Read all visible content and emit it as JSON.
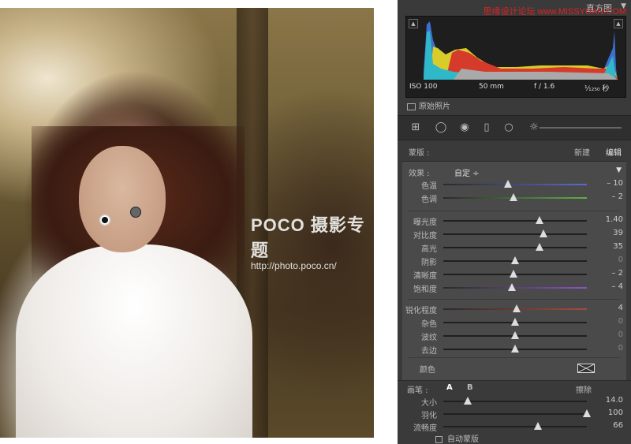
{
  "credit": "思缘设计论坛 www.MISSYUAN.COM",
  "watermark": {
    "title": "POCO 摄影专题",
    "url": "http://photo.poco.cn/"
  },
  "panel": {
    "title": "直方图",
    "exif": {
      "iso": "ISO 100",
      "focal": "50 mm",
      "aperture": "f / 1.6",
      "shutter": "¹⁄₁₂₅₀ 秒"
    },
    "original_photo": "原始照片",
    "mask": {
      "label": "蒙版 :",
      "new": "新建",
      "edit": "编辑"
    },
    "effect": {
      "label": "效果 :",
      "value": "自定 ÷"
    },
    "groups": [
      [
        {
          "label": "色温",
          "value": "– 10",
          "pos": 0.45,
          "track": "#5a6ad0",
          "dim": false
        },
        {
          "label": "色调",
          "value": "– 2",
          "pos": 0.49,
          "track": "#5fae4a",
          "dim": false
        }
      ],
      [
        {
          "label": "曝光度",
          "value": "1.40",
          "pos": 0.67,
          "dim": false
        },
        {
          "label": "对比度",
          "value": "39",
          "pos": 0.7,
          "dim": false
        },
        {
          "label": "高光",
          "value": "35",
          "pos": 0.67,
          "dim": false
        },
        {
          "label": "阴影",
          "value": "0",
          "pos": 0.5,
          "dim": true
        },
        {
          "label": "清晰度",
          "value": "– 2",
          "pos": 0.49,
          "dim": false
        },
        {
          "label": "饱和度",
          "value": "– 4",
          "pos": 0.48,
          "track": "#8f52c8",
          "dim": false
        }
      ],
      [
        {
          "label": "锐化程度",
          "value": "4",
          "pos": 0.51,
          "track": "#a84a3a",
          "dim": false
        },
        {
          "label": "杂色",
          "value": "0",
          "pos": 0.5,
          "dim": true
        },
        {
          "label": "波纹",
          "value": "0",
          "pos": 0.5,
          "dim": true
        },
        {
          "label": "去边",
          "value": "0",
          "pos": 0.5,
          "dim": true
        }
      ]
    ],
    "color_label": "颜色",
    "brush": {
      "label": "画笔 :",
      "a": "A",
      "b": "B",
      "erase": "擦除",
      "sliders": [
        {
          "label": "大小",
          "value": "14.0",
          "pos": 0.17
        },
        {
          "label": "羽化",
          "value": "100",
          "pos": 1.0
        },
        {
          "label": "流畅度",
          "value": "66",
          "pos": 0.66
        }
      ],
      "auto_mask": "自动蒙版"
    }
  }
}
